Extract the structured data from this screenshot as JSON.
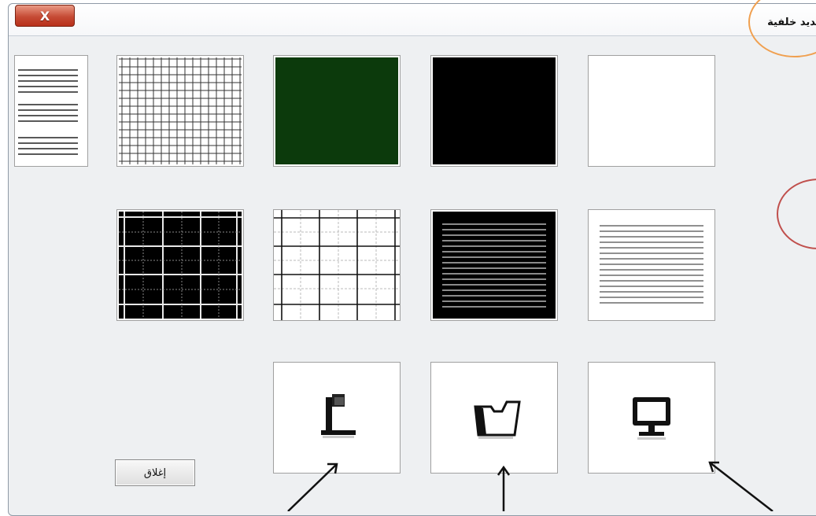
{
  "window": {
    "title": "تحديد خلفية",
    "close_glyph": "X"
  },
  "backgrounds": [
    {
      "name": "lines-white"
    },
    {
      "name": "grid-small-white"
    },
    {
      "name": "solid-dark-green",
      "color": "#0c3a0c"
    },
    {
      "name": "solid-black",
      "color": "#000000"
    },
    {
      "name": "solid-white",
      "color": "#ffffff"
    },
    {
      "name": "grid-black"
    },
    {
      "name": "grid-white-large"
    },
    {
      "name": "lines-black"
    },
    {
      "name": "lines-white-2"
    }
  ],
  "sources": [
    {
      "name": "document-camera",
      "icon": "document-camera-icon"
    },
    {
      "name": "folder",
      "icon": "folder-icon"
    },
    {
      "name": "desktop",
      "icon": "monitor-icon"
    }
  ],
  "buttons": {
    "close_label": "إغلاق"
  },
  "annotations": {
    "orange_circle_color": "#f0a050",
    "red_circle_color": "#c0504d",
    "arrow_color": "#111111"
  }
}
